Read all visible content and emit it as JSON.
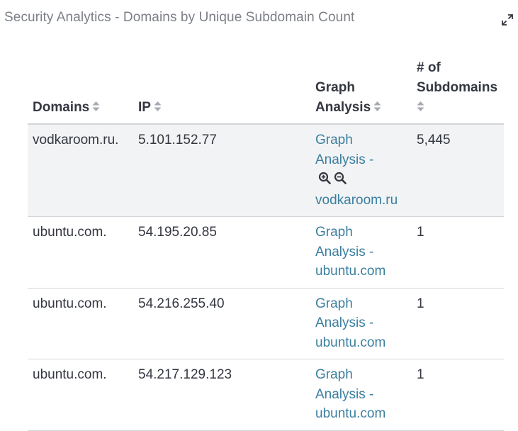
{
  "panel": {
    "title": "Security Analytics - Domains by Unique Subdomain Count",
    "expand_icon": "expand-arrows-icon"
  },
  "table": {
    "columns": [
      {
        "label": "Domains",
        "sort_icon": "sort-icon"
      },
      {
        "label": "IP",
        "sort_icon": "sort-icon"
      },
      {
        "label_line1": "Graph",
        "label_line2": "Analysis",
        "sort_icon": "sort-icon"
      },
      {
        "label_line1": "# of",
        "label_line2": "Subdomains",
        "sort_icon": "sort-icon"
      }
    ],
    "rows": [
      {
        "domain": "vodkaroom.ru.",
        "ip": "5.101.152.77",
        "link_line1": "Graph",
        "link_line2": "Analysis -",
        "link_line3": "vodkaroom.ru",
        "count": "5,445",
        "highlighted": true,
        "filter_icons": [
          "zoom-in-icon",
          "zoom-out-icon"
        ]
      },
      {
        "domain": "ubuntu.com.",
        "ip": "54.195.20.85",
        "link_line1": "Graph",
        "link_line2": "Analysis -",
        "link_line3": "ubuntu.com",
        "count": "1"
      },
      {
        "domain": "ubuntu.com.",
        "ip": "54.216.255.40",
        "link_line1": "Graph",
        "link_line2": "Analysis -",
        "link_line3": "ubuntu.com",
        "count": "1"
      },
      {
        "domain": "ubuntu.com.",
        "ip": "54.217.129.123",
        "link_line1": "Graph",
        "link_line2": "Analysis -",
        "link_line3": "ubuntu.com",
        "count": "1"
      }
    ]
  },
  "colors": {
    "link": "#3b7fa0",
    "text": "#343741",
    "title": "#7b7f86",
    "row_highlight": "#f2f3f4",
    "border": "#d3d5da"
  }
}
